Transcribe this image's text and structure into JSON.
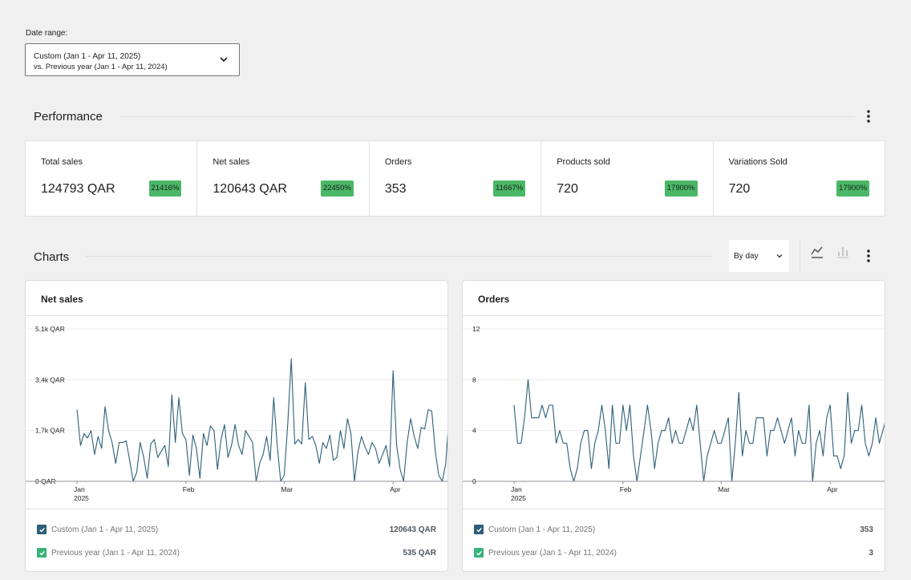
{
  "date_range": {
    "label": "Date range:",
    "primary": "Custom (Jan 1 - Apr 11, 2025)",
    "secondary": "vs. Previous year (Jan 1 - Apr 11, 2024)"
  },
  "performance": {
    "title": "Performance",
    "cards": [
      {
        "label": "Total sales",
        "value": "124793 QAR",
        "delta": "21416%"
      },
      {
        "label": "Net sales",
        "value": "120643 QAR",
        "delta": "22450%"
      },
      {
        "label": "Orders",
        "value": "353",
        "delta": "11667%"
      },
      {
        "label": "Products sold",
        "value": "720",
        "delta": "17900%"
      },
      {
        "label": "Variations Sold",
        "value": "720",
        "delta": "17900%"
      }
    ]
  },
  "charts_section": {
    "title": "Charts",
    "interval": "By day",
    "icons": {
      "line": "line-chart-icon",
      "bar": "bar-chart-icon",
      "menu": "ellipsis-menu-icon"
    }
  },
  "colors": {
    "primary_series": "#2d5f7a",
    "previous_series": "#3ab37a",
    "delta_badge": "#4ab866"
  },
  "chart_data": [
    {
      "type": "line",
      "title": "Net sales",
      "x_ticks": [
        "Jan",
        "Feb",
        "Mar",
        "Apr"
      ],
      "x_tick_year": "2025",
      "y_ticks": [
        "0 QAR",
        "1,7k QAR",
        "3,4k QAR",
        "5,1k QAR"
      ],
      "ylim": [
        0,
        5100
      ],
      "series": [
        {
          "name": "Custom (Jan 1 - Apr 11, 2025)",
          "total": "120643 QAR",
          "values": [
            2400,
            1200,
            1600,
            1450,
            1700,
            900,
            1500,
            1100,
            2500,
            1700,
            1300,
            600,
            1300,
            1300,
            1350,
            700,
            0,
            300,
            1300,
            800,
            100,
            1250,
            1400,
            800,
            1000,
            1200,
            500,
            2900,
            1300,
            2800,
            1600,
            1400,
            200,
            1550,
            1100,
            100,
            1600,
            1200,
            1850,
            1700,
            400,
            1400,
            1900,
            800,
            1200,
            1900,
            1200,
            900,
            1700,
            1500,
            1300,
            0,
            600,
            900,
            1500,
            700,
            2800,
            1200,
            0,
            200,
            1900,
            4100,
            1250,
            1400,
            1250,
            3300,
            1400,
            1500,
            1200,
            600,
            1300,
            1100,
            1550,
            700,
            800,
            1700,
            1100,
            2100,
            1600,
            0,
            1000,
            1500,
            1150,
            900,
            1300,
            1100,
            600,
            900,
            1200,
            500,
            3700,
            1200,
            400,
            0,
            1300,
            2100,
            1500,
            1100,
            1800,
            1750,
            2400,
            2350,
            1000,
            200,
            0,
            600,
            2350,
            1200,
            500,
            0
          ]
        },
        {
          "name": "Previous year (Jan 1 - Apr 11, 2024)",
          "total": "535 QAR",
          "values": [
            0,
            0,
            0,
            0,
            0,
            0,
            0,
            0,
            0,
            0,
            0,
            0,
            0,
            0,
            0,
            0,
            0,
            0,
            0,
            0,
            0,
            0,
            0,
            0,
            0,
            0,
            0,
            0,
            0,
            0,
            0,
            0,
            0,
            0,
            0,
            0,
            0,
            0,
            0,
            0,
            0,
            0,
            0,
            0,
            0,
            0,
            0,
            0,
            0,
            0,
            0,
            0,
            0,
            0,
            0,
            0,
            0,
            0,
            0,
            0,
            0,
            0,
            0,
            0,
            0,
            0,
            0,
            0,
            0,
            0,
            0,
            0,
            0,
            0,
            0,
            0,
            0,
            0,
            0,
            0,
            0,
            0,
            0,
            0,
            0,
            0,
            0,
            0,
            0,
            0,
            0,
            0,
            0,
            0,
            0,
            0,
            0,
            0,
            0,
            0,
            0,
            0,
            0,
            0,
            0,
            0,
            0,
            0,
            535,
            0
          ]
        }
      ]
    },
    {
      "type": "line",
      "title": "Orders",
      "x_ticks": [
        "Jan",
        "Feb",
        "Mar",
        "Apr"
      ],
      "x_tick_year": "2025",
      "y_ticks": [
        "0",
        "4",
        "8",
        "12"
      ],
      "ylim": [
        0,
        12
      ],
      "series": [
        {
          "name": "Custom (Jan 1 - Apr 11, 2025)",
          "total": "353",
          "values": [
            6,
            3,
            3,
            5,
            8,
            5,
            5,
            5,
            6,
            5,
            6,
            6,
            3,
            4,
            3,
            3,
            1,
            0,
            1,
            3,
            4,
            4,
            1,
            3,
            4,
            6,
            4,
            1,
            6,
            3,
            3,
            6,
            4,
            6,
            2,
            0,
            2,
            4,
            6,
            4,
            1,
            3,
            4,
            4,
            5,
            3,
            4,
            3,
            3,
            4,
            5,
            4,
            6,
            3,
            0,
            2,
            3,
            4,
            3,
            3,
            4,
            5,
            0,
            3,
            7,
            2,
            4,
            3,
            3,
            5,
            5,
            5,
            2,
            4,
            4,
            5,
            4,
            3,
            4,
            5,
            2,
            4,
            3,
            3,
            6,
            0,
            3,
            4,
            2,
            5,
            6,
            2,
            2,
            1,
            2,
            7,
            3,
            4,
            4,
            6,
            3,
            2,
            3,
            5,
            3,
            4,
            5,
            4,
            6,
            0
          ]
        },
        {
          "name": "Previous year (Jan 1 - Apr 11, 2024)",
          "total": "3",
          "values": [
            0,
            0,
            0,
            0,
            0,
            0,
            0,
            0,
            0,
            0,
            0,
            0,
            0,
            0,
            0,
            0,
            0,
            0,
            0,
            0,
            0,
            0,
            0,
            0,
            0,
            0,
            0,
            0,
            0,
            0,
            0,
            0,
            0,
            0,
            0,
            0,
            0,
            0,
            0,
            0,
            0,
            0,
            0,
            0,
            0,
            0,
            0,
            0,
            0,
            0,
            0,
            0,
            0,
            0,
            0,
            0,
            0,
            0,
            0,
            0,
            0,
            0,
            0,
            0,
            0,
            0,
            0,
            0,
            0,
            0,
            0,
            0,
            0,
            0,
            0,
            0,
            0,
            0,
            0,
            0,
            0,
            0,
            0,
            0,
            0,
            0,
            0,
            0,
            0,
            0,
            0,
            0,
            0,
            0,
            0,
            0,
            0,
            0,
            0,
            0,
            0,
            0,
            0,
            0,
            0,
            0,
            0,
            0,
            3,
            0
          ]
        }
      ]
    }
  ]
}
